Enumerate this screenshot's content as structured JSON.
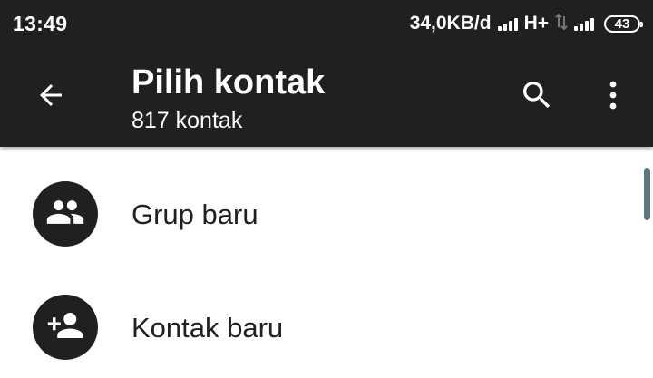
{
  "status_bar": {
    "time": "13:49",
    "net_speed": "34,0KB/d",
    "network_type": "H+",
    "battery_level": "43"
  },
  "toolbar": {
    "back_icon": "arrow-left-icon",
    "title": "Pilih kontak",
    "subtitle": "817 kontak",
    "search_icon": "search-icon",
    "more_icon": "more-vertical-icon"
  },
  "list": {
    "items": [
      {
        "label": "Grup baru",
        "icon": "group-icon"
      },
      {
        "label": "Kontak baru",
        "icon": "add-person-icon"
      }
    ]
  },
  "colors": {
    "bar_background": "#202020",
    "avatar_background": "#202020",
    "text_primary": "#202020",
    "scrollbar": "#5e7680"
  }
}
